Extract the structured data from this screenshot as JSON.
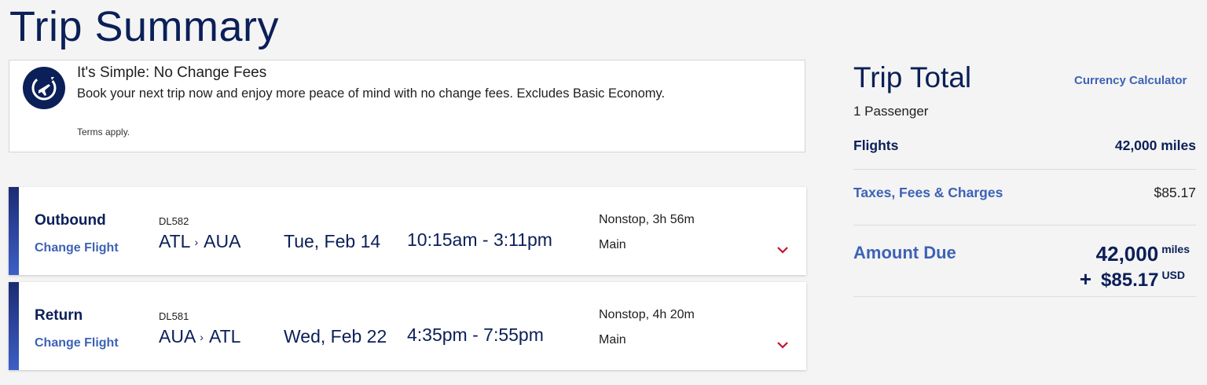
{
  "page": {
    "title": "Trip Summary"
  },
  "promo": {
    "title": "It's Simple: No Change Fees",
    "body": "Book your next trip now and enjoy more peace of mind with no change fees. Excludes Basic Economy.",
    "terms": "Terms apply.",
    "icon": "plane-circle-icon"
  },
  "flights": [
    {
      "leg": "Outbound",
      "change_label": "Change Flight",
      "flight_number": "DL582",
      "origin": "ATL",
      "destination": "AUA",
      "date": "Tue, Feb 14",
      "times": "10:15am - 3:11pm",
      "stops_duration": "Nonstop, 3h 56m",
      "cabin": "Main"
    },
    {
      "leg": "Return",
      "change_label": "Change Flight",
      "flight_number": "DL581",
      "origin": "AUA",
      "destination": "ATL",
      "date": "Wed, Feb 22",
      "times": "4:35pm - 7:55pm",
      "stops_duration": "Nonstop, 4h 20m",
      "cabin": "Main"
    }
  ],
  "summary": {
    "title": "Trip Total",
    "currency_calculator": "Currency Calculator",
    "passengers": "1 Passenger",
    "flights_label": "Flights",
    "flights_value": "42,000 miles",
    "taxes_label": "Taxes, Fees & Charges",
    "taxes_value": "$85.17",
    "amount_due_label": "Amount Due",
    "amount_miles": "42,000",
    "amount_miles_unit": "miles",
    "amount_plus": "+",
    "amount_usd": "$85.17",
    "amount_usd_unit": "USD"
  },
  "colors": {
    "navy": "#0b1f58",
    "accent_blue": "#3d62b5",
    "chevron_red": "#c8102e"
  }
}
